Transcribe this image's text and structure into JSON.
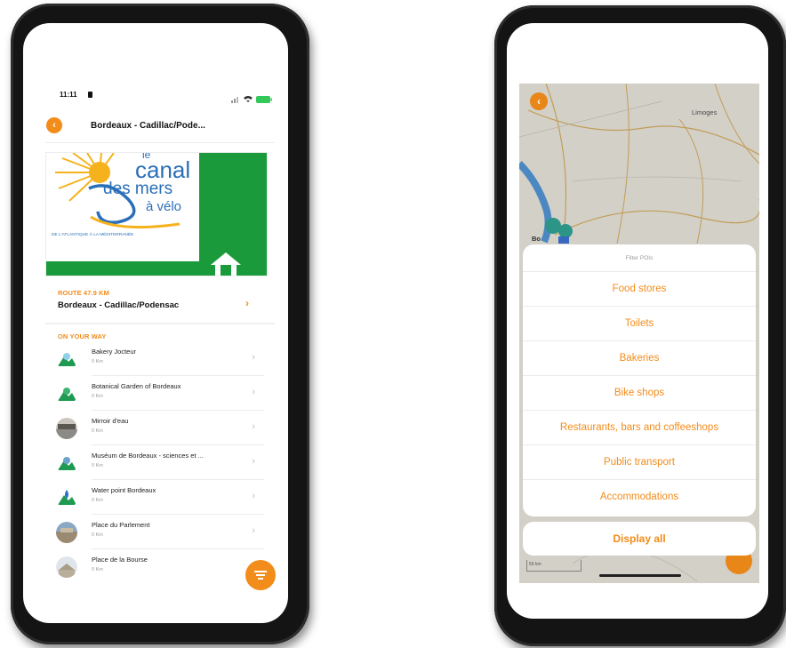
{
  "left_phone": {
    "status": {
      "time": "11:11"
    },
    "nav": {
      "back_icon": "chevron-left-icon",
      "title": "Bordeaux - Cadillac/Pode..."
    },
    "banner": {
      "logo_line1": "le",
      "logo_line2": "canal",
      "logo_line3": "des mers",
      "logo_line4": "à vélo",
      "tagline": "DE L'ATLANTIQUE À LA MÉDITERRANÉE",
      "brand_green": "#1a9a3a"
    },
    "route": {
      "label": "ROUTE 47.9 KM",
      "name": "Bordeaux - Cadillac/Podensac",
      "chevron": "›"
    },
    "on_your_way": {
      "label": "ON YOUR WAY",
      "items": [
        {
          "name": "Bakery Jocteur",
          "distance": "0 Km",
          "icon": "bakery-icon"
        },
        {
          "name": "Botanical Garden of Bordeaux",
          "distance": "0 Km",
          "icon": "garden-icon"
        },
        {
          "name": "Mirroir d'eau",
          "distance": "0 Km",
          "icon": "landmark-photo-icon"
        },
        {
          "name": "Muséum de Bordeaux - sciences et ...",
          "distance": "0 Km",
          "icon": "museum-icon"
        },
        {
          "name": "Water point Bordeaux",
          "distance": "0 Km",
          "icon": "water-drop-icon"
        },
        {
          "name": "Place du Parlement",
          "distance": "0 Km",
          "icon": "landmark-photo-icon"
        },
        {
          "name": "Place de la Bourse",
          "distance": "0 Km",
          "icon": "landmark-photo-icon"
        }
      ]
    },
    "fab_icon": "filter-icon"
  },
  "right_phone": {
    "map": {
      "city_label": "Limoges",
      "city_label_2": "Bo",
      "scale": "50 km"
    },
    "filter_sheet": {
      "title": "Filter POIs",
      "options": [
        "Food stores",
        "Toilets",
        "Bakeries",
        "Bike shops",
        "Restaurants, bars and coffeeshops",
        "Public transport",
        "Accommodations"
      ],
      "display_all": "Display all"
    }
  },
  "colors": {
    "accent": "#f28c1a",
    "map_bg": "#dad7cf",
    "map_road": "#c9a45a",
    "water": "#4f8ec9"
  }
}
